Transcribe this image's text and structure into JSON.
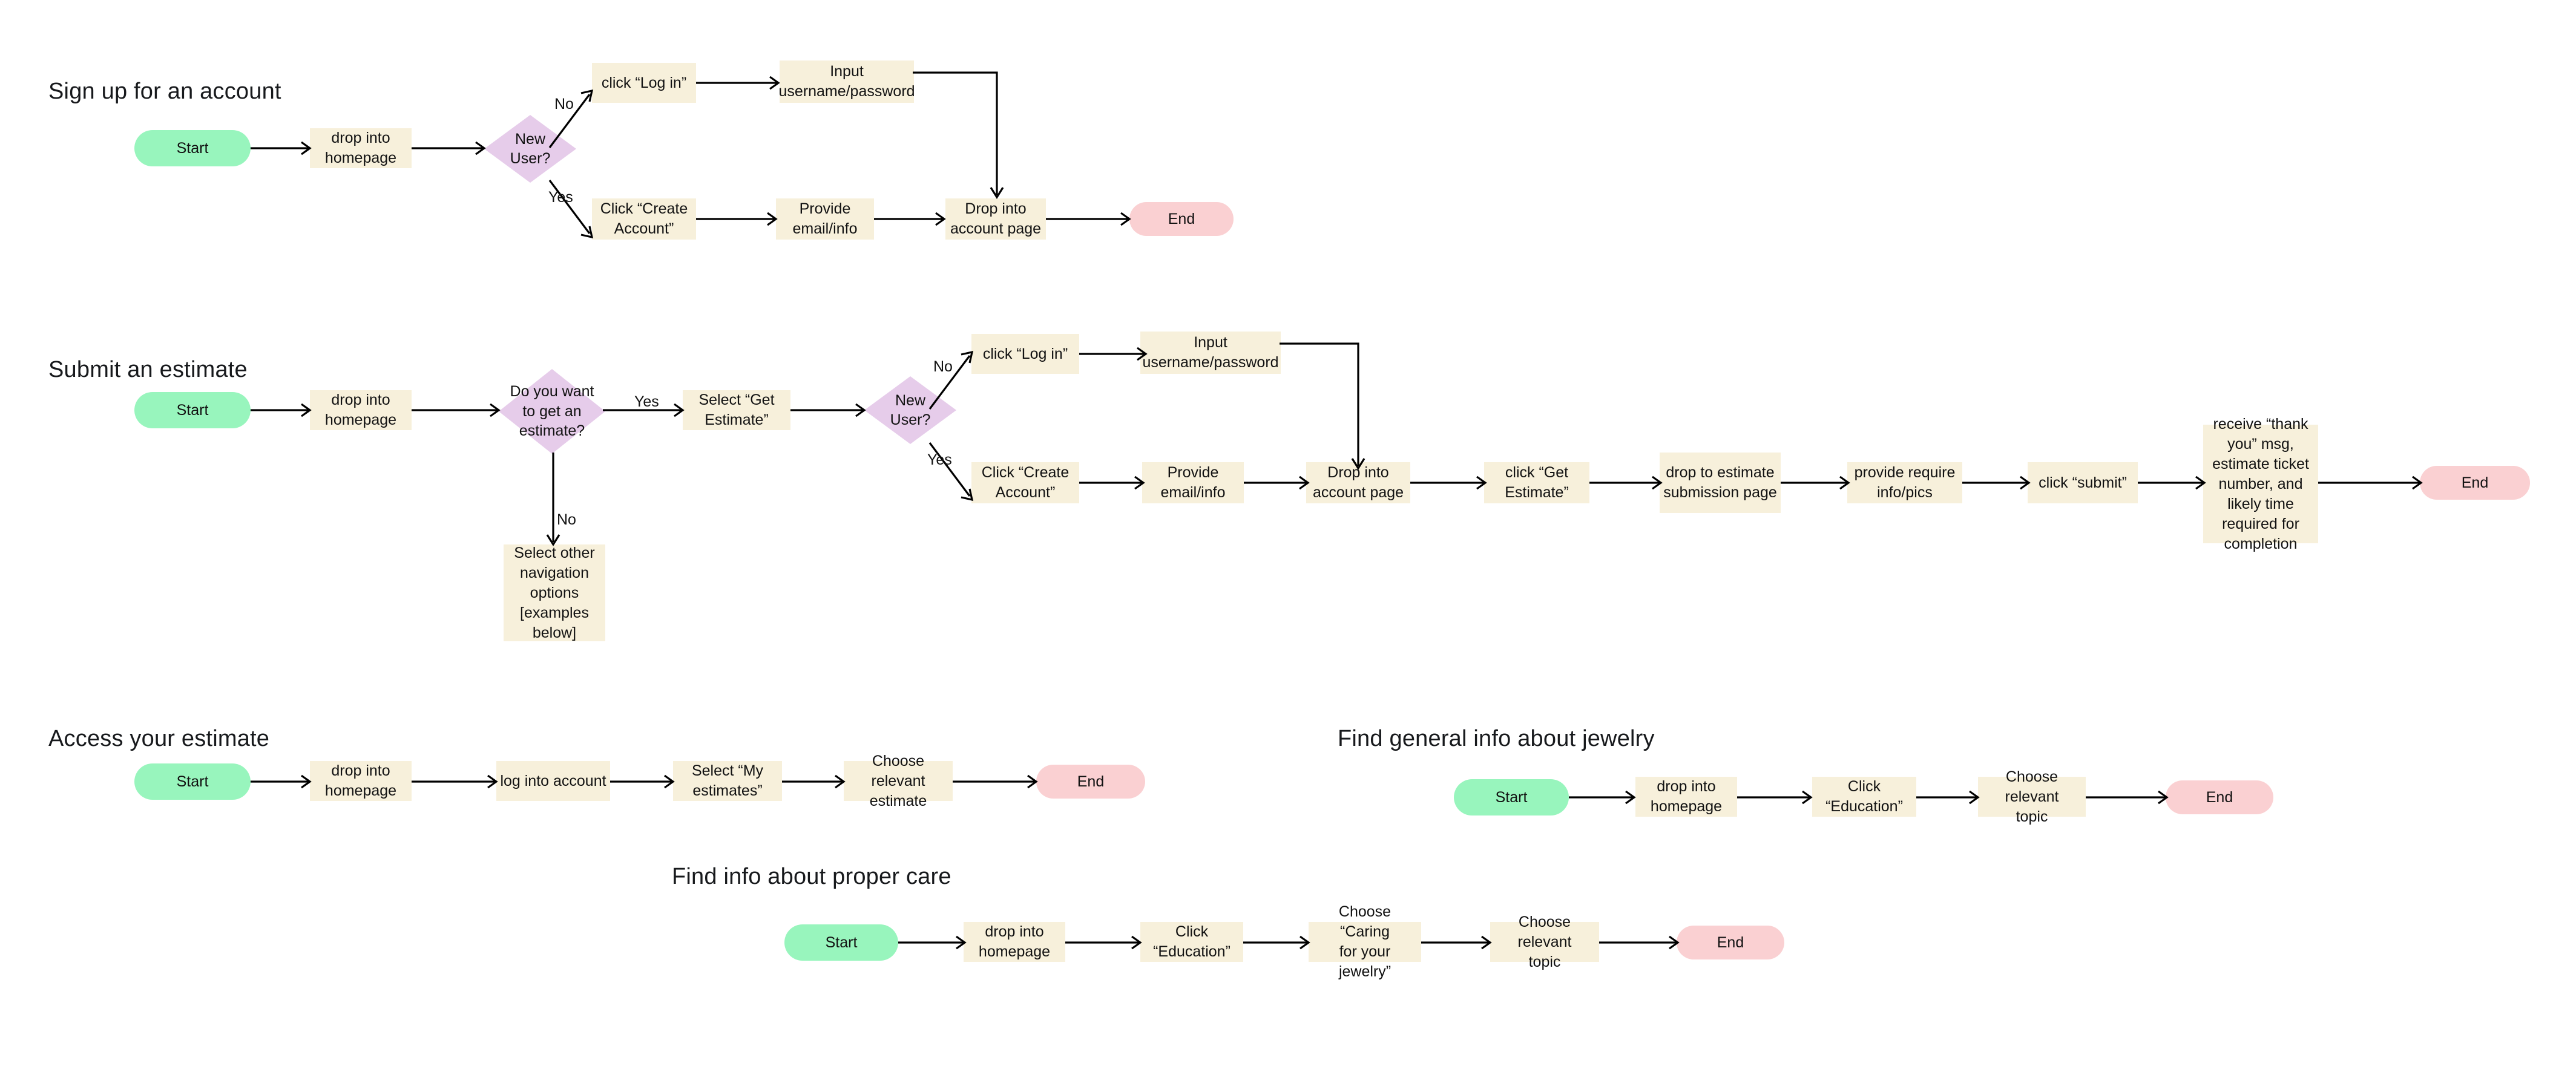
{
  "diagram": {
    "type": "flowchart",
    "background": "#ffffff",
    "palette": {
      "start_fill": "#98f5bd",
      "end_fill": "#fad0d2",
      "process_fill": "#f7f0db",
      "decision_fill": "#e6ccea",
      "connector_stroke": "#000000",
      "text": "#121212"
    },
    "sections": [
      {
        "id": "sign-up-for-an-account",
        "title": "Sign up for an account",
        "nodes": [
          {
            "id": "s1-start",
            "kind": "start",
            "label": "Start"
          },
          {
            "id": "s1-homepage",
            "kind": "process",
            "label": "drop into\nhomepage"
          },
          {
            "id": "s1-new-user",
            "kind": "decision",
            "label": "New\nUser?"
          },
          {
            "id": "s1-click-login",
            "kind": "process",
            "label": "click “Log in”"
          },
          {
            "id": "s1-input-credentials",
            "kind": "process",
            "label": "Input\nusername/password"
          },
          {
            "id": "s1-click-create-account",
            "kind": "process",
            "label": "Click “Create\nAccount”"
          },
          {
            "id": "s1-provide-email",
            "kind": "process",
            "label": "Provide\nemail/info"
          },
          {
            "id": "s1-drop-account-page",
            "kind": "process",
            "label": "Drop into\naccount page"
          },
          {
            "id": "s1-end",
            "kind": "end",
            "label": "End"
          }
        ],
        "edge_labels": [
          {
            "id": "s1-no",
            "label": "No"
          },
          {
            "id": "s1-yes",
            "label": "Yes"
          }
        ]
      },
      {
        "id": "submit-an-estimate",
        "title": "Submit an estimate",
        "nodes": [
          {
            "id": "s2-start",
            "kind": "start",
            "label": "Start"
          },
          {
            "id": "s2-homepage",
            "kind": "process",
            "label": "drop into\nhomepage"
          },
          {
            "id": "s2-want-estimate",
            "kind": "decision",
            "label": "Do you want\nto get an\nestimate?"
          },
          {
            "id": "s2-select-get-estimate",
            "kind": "process",
            "label": "Select “Get\nEstimate”"
          },
          {
            "id": "s2-new-user",
            "kind": "decision",
            "label": "New\nUser?"
          },
          {
            "id": "s2-click-login",
            "kind": "process",
            "label": "click “Log in”"
          },
          {
            "id": "s2-input-credentials",
            "kind": "process",
            "label": "Input\nusername/password"
          },
          {
            "id": "s2-click-create-account",
            "kind": "process",
            "label": "Click “Create\nAccount”"
          },
          {
            "id": "s2-provide-email",
            "kind": "process",
            "label": "Provide\nemail/info"
          },
          {
            "id": "s2-drop-account-page",
            "kind": "process",
            "label": "Drop into\naccount page"
          },
          {
            "id": "s2-click-get-estimate",
            "kind": "process",
            "label": "click “Get\nEstimate”"
          },
          {
            "id": "s2-drop-submission-page",
            "kind": "process",
            "label": "drop to estimate\nsubmission page"
          },
          {
            "id": "s2-provide-info-pics",
            "kind": "process",
            "label": "provide require\ninfo/pics"
          },
          {
            "id": "s2-click-submit",
            "kind": "process",
            "label": "click “submit”"
          },
          {
            "id": "s2-receive-thank-you",
            "kind": "process",
            "label": "receive “thank\nyou” msg,\nestimate ticket\nnumber, and\nlikely time\nrequired for\ncompletion"
          },
          {
            "id": "s2-end",
            "kind": "end",
            "label": "End"
          },
          {
            "id": "s2-select-other-nav",
            "kind": "process",
            "label": "Select other\nnavigation\noptions\n[examples\nbelow]"
          }
        ],
        "edge_labels": [
          {
            "id": "s2-yes-estimate",
            "label": "Yes"
          },
          {
            "id": "s2-no-estimate",
            "label": "No"
          },
          {
            "id": "s2-no-newuser",
            "label": "No"
          },
          {
            "id": "s2-yes-newuser",
            "label": "Yes"
          }
        ]
      },
      {
        "id": "access-your-estimate",
        "title": "Access your estimate",
        "nodes": [
          {
            "id": "s3-start",
            "kind": "start",
            "label": "Start"
          },
          {
            "id": "s3-homepage",
            "kind": "process",
            "label": "drop into\nhomepage"
          },
          {
            "id": "s3-log-into-account",
            "kind": "process",
            "label": "log into account"
          },
          {
            "id": "s3-select-my-estimates",
            "kind": "process",
            "label": "Select “My\nestimates”"
          },
          {
            "id": "s3-choose-estimate",
            "kind": "process",
            "label": "Choose relevant\nestimate"
          },
          {
            "id": "s3-end",
            "kind": "end",
            "label": "End"
          }
        ],
        "edge_labels": []
      },
      {
        "id": "find-general-info-about-jewelry",
        "title": "Find general info about jewelry",
        "nodes": [
          {
            "id": "s4-start",
            "kind": "start",
            "label": "Start"
          },
          {
            "id": "s4-homepage",
            "kind": "process",
            "label": "drop into\nhomepage"
          },
          {
            "id": "s4-click-education",
            "kind": "process",
            "label": "Click\n“Education”"
          },
          {
            "id": "s4-choose-topic",
            "kind": "process",
            "label": "Choose relevant\ntopic"
          },
          {
            "id": "s4-end",
            "kind": "end",
            "label": "End"
          }
        ],
        "edge_labels": []
      },
      {
        "id": "find-info-about-proper-care",
        "title": "Find info about proper care",
        "nodes": [
          {
            "id": "s5-start",
            "kind": "start",
            "label": "Start"
          },
          {
            "id": "s5-homepage",
            "kind": "process",
            "label": "drop into\nhomepage"
          },
          {
            "id": "s5-click-education",
            "kind": "process",
            "label": "Click\n“Education”"
          },
          {
            "id": "s5-choose-caring",
            "kind": "process",
            "label": "Choose “Caring\nfor your jewelry”"
          },
          {
            "id": "s5-choose-topic",
            "kind": "process",
            "label": "Choose relevant\ntopic"
          },
          {
            "id": "s5-end",
            "kind": "end",
            "label": "End"
          }
        ],
        "edge_labels": []
      }
    ]
  }
}
